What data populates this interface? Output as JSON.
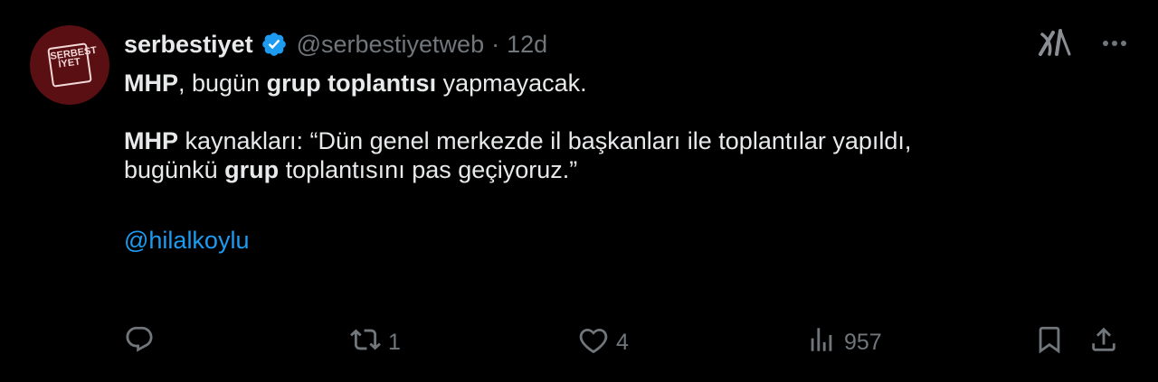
{
  "author": {
    "display_name": "serbestiyet",
    "handle": "@serbestiyetweb",
    "separator": "·",
    "time": "12d",
    "verified": true,
    "avatar_bg": "#5a0f13",
    "avatar_text": "SERBEST İYET"
  },
  "tweet": {
    "line1": {
      "b1": "MHP",
      "t1": ", bugün ",
      "b2": "grup toplantısı",
      "t2": " yapmayacak."
    },
    "line2": {
      "b1": "MHP",
      "t1": " kaynakları: “Dün genel merkezde il başkanları ile toplantılar yapıldı,"
    },
    "line3": {
      "t0": "bugünkü ",
      "b1": "grup",
      "t1": " toplantısını pas geçiyoruz.”"
    },
    "mention": "@hilalkoylu"
  },
  "actions": {
    "reply_count": "",
    "retweet_count": "1",
    "like_count": "4",
    "views_count": "957"
  },
  "colors": {
    "background": "#000000",
    "text": "#e7e9ea",
    "muted": "#71767b",
    "accent": "#1d9bf0"
  },
  "icons": [
    "verified-badge-icon",
    "grok-icon",
    "more-icon",
    "reply-icon",
    "retweet-icon",
    "like-icon",
    "views-icon",
    "bookmark-icon",
    "share-icon"
  ]
}
